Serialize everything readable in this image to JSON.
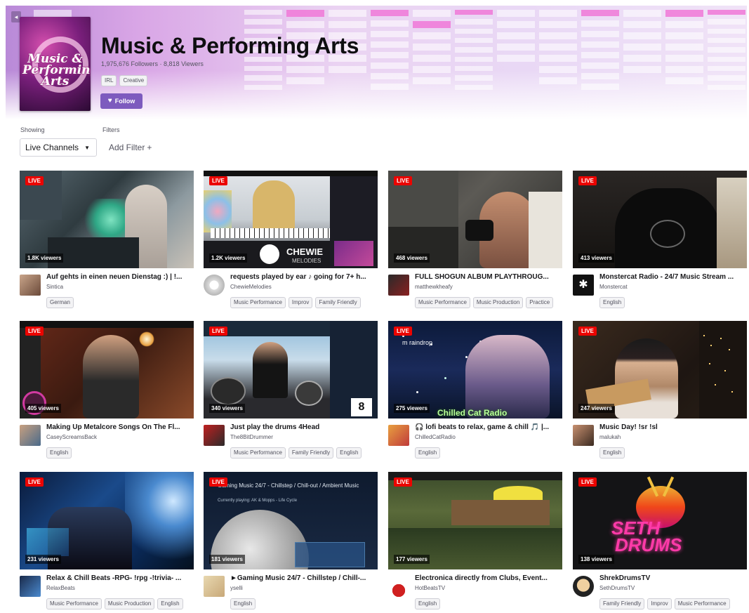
{
  "category": {
    "title": "Music & Performing Arts",
    "stats": "1,975,676 Followers · 8,818 Viewers",
    "tags": [
      "IRL",
      "Creative"
    ],
    "follow_label": "Follow",
    "boxart_text": "Music & Performing Arts",
    "back_icon": "◂"
  },
  "filters": {
    "showing_label": "Showing",
    "filters_label": "Filters",
    "selected": "Live Channels",
    "add_filter": "Add Filter"
  },
  "colors": {
    "brand": "#7d5bbe",
    "live": "#eb0400"
  },
  "streams": [
    {
      "live": "LIVE",
      "viewers": "1.8K viewers",
      "title": "Auf gehts in einen neuen Dienstag :) | !...",
      "channel": "Sintica",
      "tags": [
        "German"
      ]
    },
    {
      "live": "LIVE",
      "viewers": "1.2K viewers",
      "title": "requests played by ear ♪ going for 7+ h...",
      "channel": "ChewieMelodies",
      "tags": [
        "Music Performance",
        "Improv",
        "Family Friendly"
      ]
    },
    {
      "live": "LIVE",
      "viewers": "468 viewers",
      "title": "FULL SHOGUN ALBUM PLAYTHROUG...",
      "channel": "matthewkheafy",
      "tags": [
        "Music Performance",
        "Music Production",
        "Practice"
      ]
    },
    {
      "live": "LIVE",
      "viewers": "413 viewers",
      "title": "Monstercat Radio - 24/7 Music Stream ...",
      "channel": "Monstercat",
      "tags": [
        "English"
      ]
    },
    {
      "live": "LIVE",
      "viewers": "405 viewers",
      "title": "Making Up Metalcore Songs On The Fl...",
      "channel": "CaseyScreamsBack",
      "tags": [
        "English"
      ]
    },
    {
      "live": "LIVE",
      "viewers": "340 viewers",
      "title": "Just play the drums 4Head",
      "channel": "The8BitDrummer",
      "tags": [
        "Music Performance",
        "Family Friendly",
        "English"
      ]
    },
    {
      "live": "LIVE",
      "viewers": "275 viewers",
      "title": "🎧 lofi beats to relax, game & chill 🎵 |...",
      "channel": "ChilledCatRadio",
      "tags": [
        "English"
      ]
    },
    {
      "live": "LIVE",
      "viewers": "247 viewers",
      "title": "Music Day! !sr !sl",
      "channel": "malukah",
      "tags": [
        "English"
      ]
    },
    {
      "live": "LIVE",
      "viewers": "231 viewers",
      "title": "Relax & Chill Beats -RPG- !rpg -!trivia- ...",
      "channel": "RelaxBeats",
      "tags": [
        "Music Performance",
        "Music Production",
        "English"
      ]
    },
    {
      "live": "LIVE",
      "viewers": "181 viewers",
      "title": "►Gaming Music 24/7 - Chillstep / Chill-...",
      "channel": "yselli",
      "tags": [
        "English"
      ]
    },
    {
      "live": "LIVE",
      "viewers": "177 viewers",
      "title": "Electronica directly from Clubs, Event...",
      "channel": "HotBeatsTV",
      "tags": [
        "English"
      ]
    },
    {
      "live": "LIVE",
      "viewers": "138 viewers",
      "title": "ShrekDrumsTV",
      "channel": "SethDrumsTV",
      "tags": [
        "Family Friendly",
        "Improv",
        "Music Performance"
      ]
    }
  ],
  "thumb_text": {
    "chewie": "CHEWIE",
    "chewie_sub": "MELODIES",
    "chilled": "Chilled Cat Radio",
    "raindrop": "m raindrop",
    "gaming_music": "Gaming Music 24/7 - Chillstep / Chill-out / Ambient Music",
    "currently": "Currently playing: AK & Mopps - Life Cycle",
    "seth1": "SETH",
    "seth2": "DRUMS",
    "drum_num": "8"
  }
}
